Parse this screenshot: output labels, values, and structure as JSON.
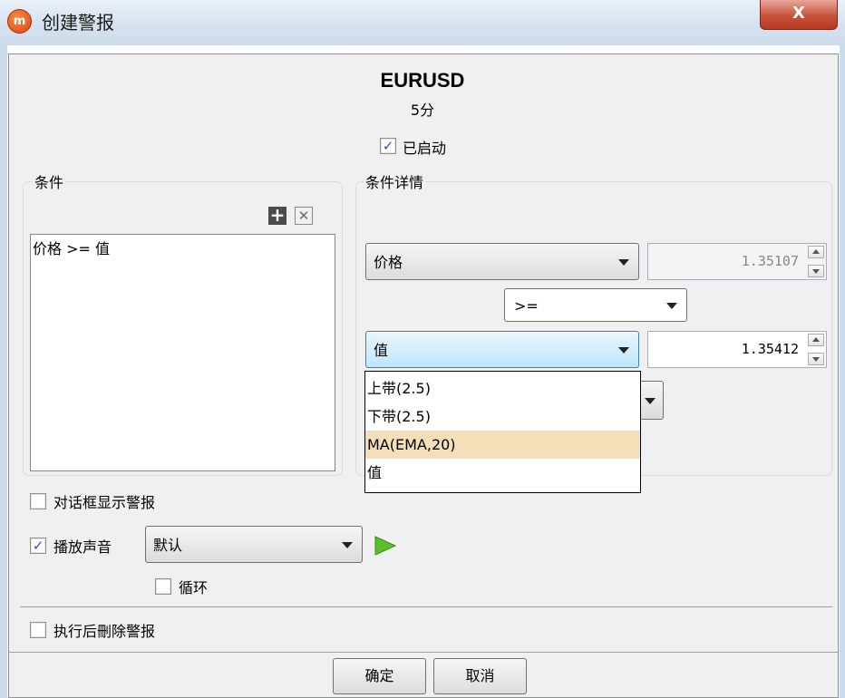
{
  "window": {
    "title": "创建警报",
    "close_label": "X"
  },
  "header": {
    "symbol": "EURUSD",
    "timeframe": "5分",
    "enabled_label": "已启动",
    "enabled_checked": true
  },
  "conditions": {
    "title": "条件",
    "add_icon": "plus-icon",
    "remove_icon": "x-box-icon",
    "items": [
      "价格 >= 值"
    ]
  },
  "details": {
    "title": "条件详情",
    "left_select": "价格",
    "left_value": "1.35107",
    "operator": ">=",
    "right_select": "值",
    "right_value": "1.35412",
    "dropdown_options": [
      "上带(2.5)",
      "下带(2.5)",
      "MA(EMA,20)",
      "值"
    ],
    "hovered_option": "MA(EMA,20)"
  },
  "options": {
    "show_dialog_label": "对话框显示警报",
    "show_dialog_checked": false,
    "play_sound_label": "播放声音",
    "play_sound_checked": true,
    "sound_select": "默认",
    "loop_label": "循环",
    "loop_checked": false,
    "delete_after_label": "执行后刪除警报",
    "delete_after_checked": false
  },
  "buttons": {
    "ok": "确定",
    "cancel": "取消"
  },
  "colors": {
    "highlight": "#f4dfb8",
    "play_icon": "#5bbf2a"
  }
}
